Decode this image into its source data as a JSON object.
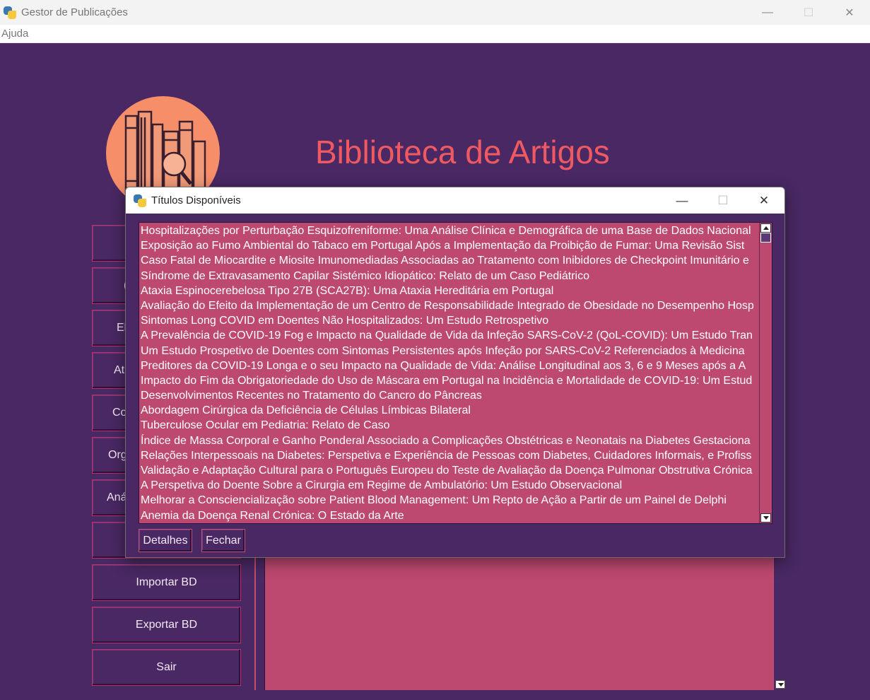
{
  "window": {
    "title": "Gestor de Publicações",
    "controls": {
      "minimize": "—",
      "maximize": "☐",
      "close": "✕"
    }
  },
  "menu": {
    "items": [
      "Ajuda"
    ]
  },
  "header": {
    "title": "Biblioteca de Artigos"
  },
  "sidebar": {
    "buttons": [
      {
        "label": ""
      },
      {
        "label": "("
      },
      {
        "label": "El"
      },
      {
        "label": "At"
      },
      {
        "label": "Co"
      },
      {
        "label": "Org"
      },
      {
        "label": "Aná"
      },
      {
        "label": ""
      },
      {
        "label": "Importar BD"
      },
      {
        "label": "Exportar BD"
      },
      {
        "label": "Sair"
      }
    ]
  },
  "dialog": {
    "title": "Títulos Disponíveis",
    "controls": {
      "minimize": "—",
      "maximize": "☐",
      "close": "✕"
    },
    "items": [
      "Hospitalizações por Perturbação Esquizofreniforme: Uma Análise Clínica e Demográfica de uma Base de Dados Nacional",
      "Exposição ao Fumo Ambiental do Tabaco em Portugal Após a Implementação da Proibição de Fumar: Uma Revisão Sist",
      "Caso Fatal de Miocardite e Miosite Imunomediadas Associadas ao Tratamento com Inibidores de Checkpoint Imunitário e",
      "Síndrome de Extravasamento Capilar Sistémico Idiopático: Relato de um Caso Pediátrico",
      "Ataxia Espinocerebelosa Tipo 27B (SCA27B): Uma Ataxia Hereditária em Portugal",
      "Avaliação do Efeito da Implementação de um Centro de Responsabilidade Integrado de Obesidade no Desempenho Hosp",
      "Sintomas Long COVID em Doentes Não Hospitalizados: Um Estudo Retrospetivo",
      "A Prevalência de COVID-19 Fog e Impacto na Qualidade de Vida da Infeção SARS-CoV-2 (QoL-COVID): Um Estudo Tran",
      "Um Estudo Prospetivo de Doentes com Sintomas Persistentes após Infeção por SARS-CoV-2 Referenciados à Medicina",
      "Preditores da COVID-19 Longa e o seu Impacto na Qualidade de Vida: Análise Longitudinal aos 3, 6 e 9 Meses após a A",
      "Impacto do Fim da Obrigatoriedade do Uso de Máscara em Portugal na Incidência e Mortalidade de COVID-19: Um Estud",
      "Desenvolvimentos Recentes no Tratamento do Cancro do Pâncreas",
      "Abordagem Cirúrgica da Deficiência de Células Límbicas Bilateral",
      "Tuberculose Ocular em Pediatria: Relato de Caso",
      "Índice de Massa Corporal e Ganho Ponderal Associado a Complicações Obstétricas e Neonatais na Diabetes Gestaciona",
      "Relações Interpessoais na Diabetes: Perspetiva e Experiência de Pessoas com Diabetes, Cuidadores Informais, e Profiss",
      "Validação e Adaptação Cultural para o Português Europeu do Teste de Avaliação da Doença Pulmonar Obstrutiva Crónica",
      "A Perspetiva do Doente Sobre a Cirurgia em Regime de Ambulatório: Um Estudo Observacional",
      "Melhorar a Consciencialização sobre Patient Blood Management: Um Repto de Ação a Partir de um Painel de Delphi",
      "Anemia da Doença Renal Crónica: O Estado da Arte"
    ],
    "buttons": {
      "details": "Detalhes",
      "close": "Fechar"
    }
  },
  "colors": {
    "background": "#4a2863",
    "accent": "#ef5a62",
    "list_bg": "#bd4870",
    "logo_bg": "#f68e6a"
  }
}
